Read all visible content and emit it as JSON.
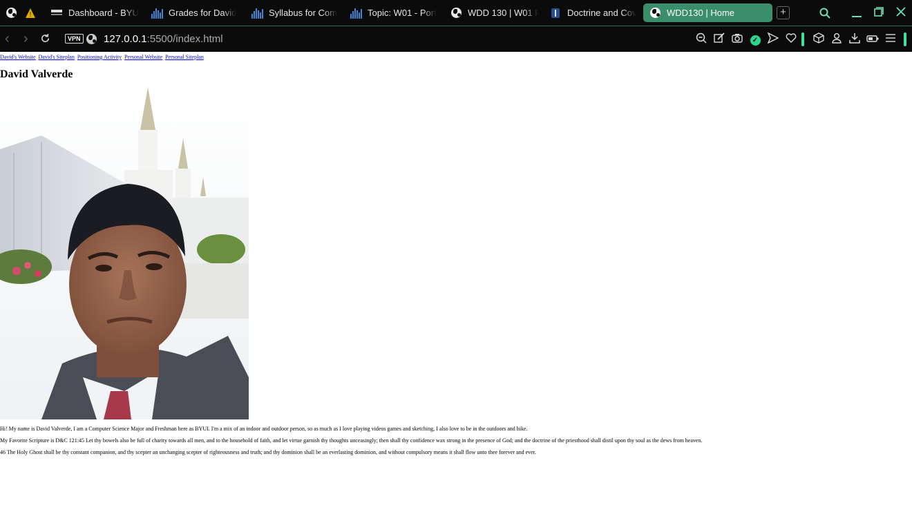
{
  "tabs": [
    {
      "label": "",
      "icon": "globe-icon"
    },
    {
      "label": "",
      "icon": "warning-icon"
    },
    {
      "label": "Dashboard - BYU",
      "icon": "byu-logo-icon"
    },
    {
      "label": "Grades for David",
      "icon": "bars-icon"
    },
    {
      "label": "Syllabus for Com",
      "icon": "bars-icon"
    },
    {
      "label": "Topic: W01 - Port",
      "icon": "bars-icon"
    },
    {
      "label": "WDD 130 | W01 P",
      "icon": "globe-icon"
    },
    {
      "label": "Doctrine and Cov",
      "icon": "scripture-icon"
    },
    {
      "label": "WDD130 | Home",
      "icon": "globe-icon"
    }
  ],
  "address": {
    "vpn": "VPN",
    "host": "127.0.0.1",
    "path": ":5500/index.html"
  },
  "page": {
    "links": [
      "David's Website",
      "David's Siteplan",
      "Positioning Activity",
      "Personal Website",
      "Personal Siteplan"
    ],
    "title": "David Valverde",
    "paragraphs": [
      "Hi! My name is David Valverde, I am a Computer Science Major and Freshman here as BYUI. I'm a mix of an indoor and outdoor person, so as much as I love playing videos games and sketching, I also love to be in the outdoors and hike.",
      "My Favorite Scripture is D&C 121:45 Let thy bowels also be full of charity towards all men, and to the household of faith, and let virtue garnish thy thoughts unceasingly; then shall thy confidence wax strong in the presence of God; and the doctrine of the priesthood shall distil upon thy soul as the dews from heaven.",
      "46 The Holy Ghost shall be thy constant companion, and thy scepter an unchanging scepter of righteousness and truth; and thy dominion shall be an everlasting dominion, and without compulsory means it shall flow unto thee forever and ever."
    ]
  },
  "colors": {
    "chrome": "#0b0b0b",
    "accent": "#3ee29d",
    "active_tab": "#3a8f6a",
    "link": "#0000ee"
  }
}
